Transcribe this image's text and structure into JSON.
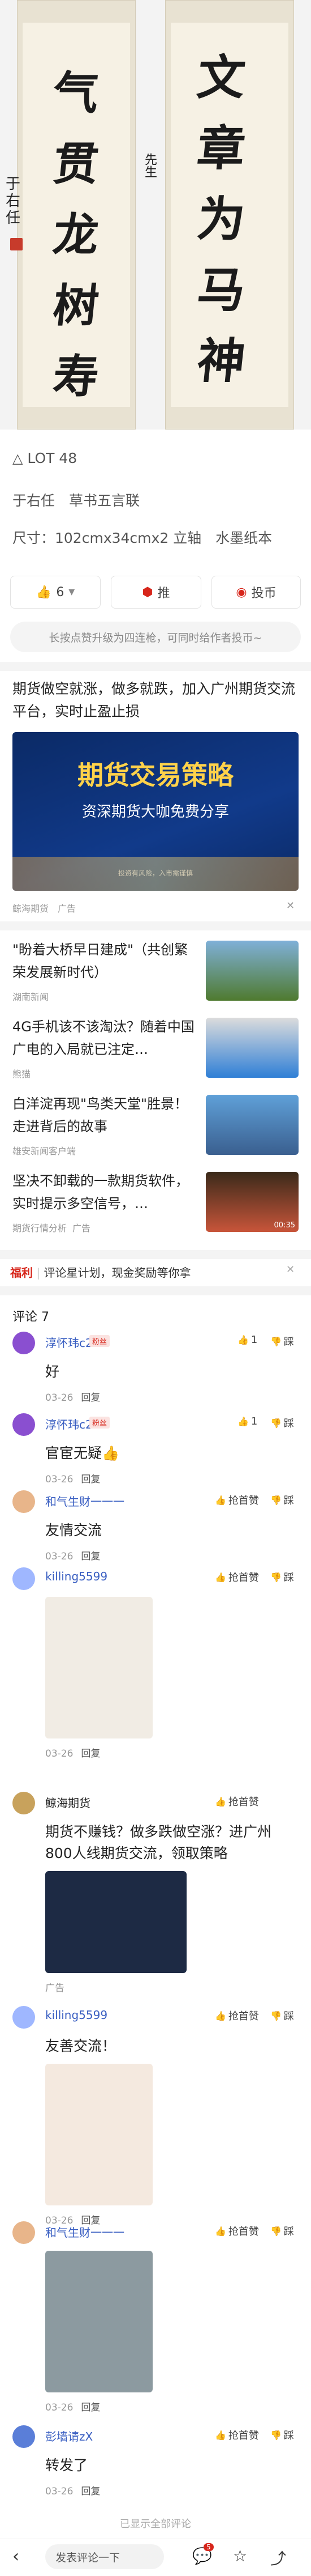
{
  "artwork": {
    "right_column": [
      "文",
      "章",
      "为",
      "马",
      "神"
    ],
    "left_column": [
      "气",
      "贯",
      "龙",
      "树",
      "寿"
    ],
    "inscription_right": "先生",
    "signature": "于右任"
  },
  "lot": {
    "icon": "triangle-warning-icon",
    "label": "LOT 48"
  },
  "title": "于右任　草书五言联",
  "size": "尺寸：102cmx34cmx2 立轴　水墨纸本",
  "actions": {
    "like_count": "6",
    "recommend": "推",
    "vote": "投币"
  },
  "hint": "长按点赞升级为四连枪，可同时给作者投币~",
  "ad_top": {
    "text": "期货做空就涨，做多就跌，加入广州期货交流平台，实时止盈止损",
    "banner_title": "期货交易策略",
    "banner_sub": "资深期货大咖免费分享",
    "banner_foot": "投资有风险，入市需谨慎",
    "source": "鲸海期货",
    "tag": "广告"
  },
  "news": [
    {
      "title": "\"盼着大桥早日建成\"（共创繁荣发展新时代）",
      "source": "湖南新闻"
    },
    {
      "title": "4G手机该不该淘汰？随着中国广电的入局就已注定…",
      "source": "熊猫"
    },
    {
      "title": "白洋淀再现\"鸟类天堂\"胜景！走进背后的故事",
      "source": "雄安新闻客户端"
    },
    {
      "title": "坚决不卸载的一款期货软件，实时提示多空信号，…",
      "source": "期货行情分析",
      "tag": "广告",
      "duration": "00:35"
    }
  ],
  "welfare": {
    "label": "福利",
    "text": "评论星计划，现金奖励等你拿"
  },
  "comments_header": "评论 7",
  "comments": [
    {
      "name": "淳怀玮c2",
      "badge": "粉丝",
      "text": "好",
      "date": "03-26",
      "reply": "回复",
      "likes": "1",
      "dislike": "踩",
      "avatar": "#8a4fd0"
    },
    {
      "name": "淳怀玮c2",
      "badge": "粉丝",
      "text": "官宦无疑👍",
      "date": "03-26",
      "reply": "回复",
      "likes": "1",
      "dislike": "踩",
      "avatar": "#8a4fd0"
    },
    {
      "name": "和气生财一一一",
      "text": "友情交流",
      "date": "03-26",
      "reply": "回复",
      "likes": "抢首赞",
      "dislike": "踩",
      "avatar": "#e8b58a"
    },
    {
      "name": "killing5599",
      "text": "",
      "date": "03-26",
      "reply": "回复",
      "likes": "抢首赞",
      "dislike": "踩",
      "avatar": "#9fb7ff"
    },
    {
      "name": "鲸海期货",
      "text": "期货不赚钱？做多跌做空涨？进广州800人线期货交流，领取策略",
      "date": "",
      "reply": "",
      "likes": "抢首赞",
      "dislike": "",
      "tag": "广告",
      "avatar": "#c8a25c"
    },
    {
      "name": "killing5599",
      "text": "友善交流！",
      "date": "03-26",
      "reply": "回复",
      "likes": "抢首赞",
      "dislike": "踩",
      "avatar": "#9fb7ff"
    },
    {
      "name": "和气生财一一一",
      "text": "",
      "date": "03-26",
      "reply": "回复",
      "likes": "抢首赞",
      "dislike": "踩",
      "avatar": "#e8b58a"
    },
    {
      "name": "彭墙请zX",
      "text": "转发了",
      "date": "03-26",
      "reply": "回复",
      "likes": "抢首赞",
      "dislike": "踩",
      "avatar": "#5a7ed8"
    }
  ],
  "footer": {
    "end": "已显示全部评论",
    "input_placeholder": "发表评论一下",
    "comment_count": "5"
  },
  "colors": {
    "accent": "#d7261b",
    "link": "#3a5fc2",
    "bg_gap": "#f4f4f4"
  }
}
